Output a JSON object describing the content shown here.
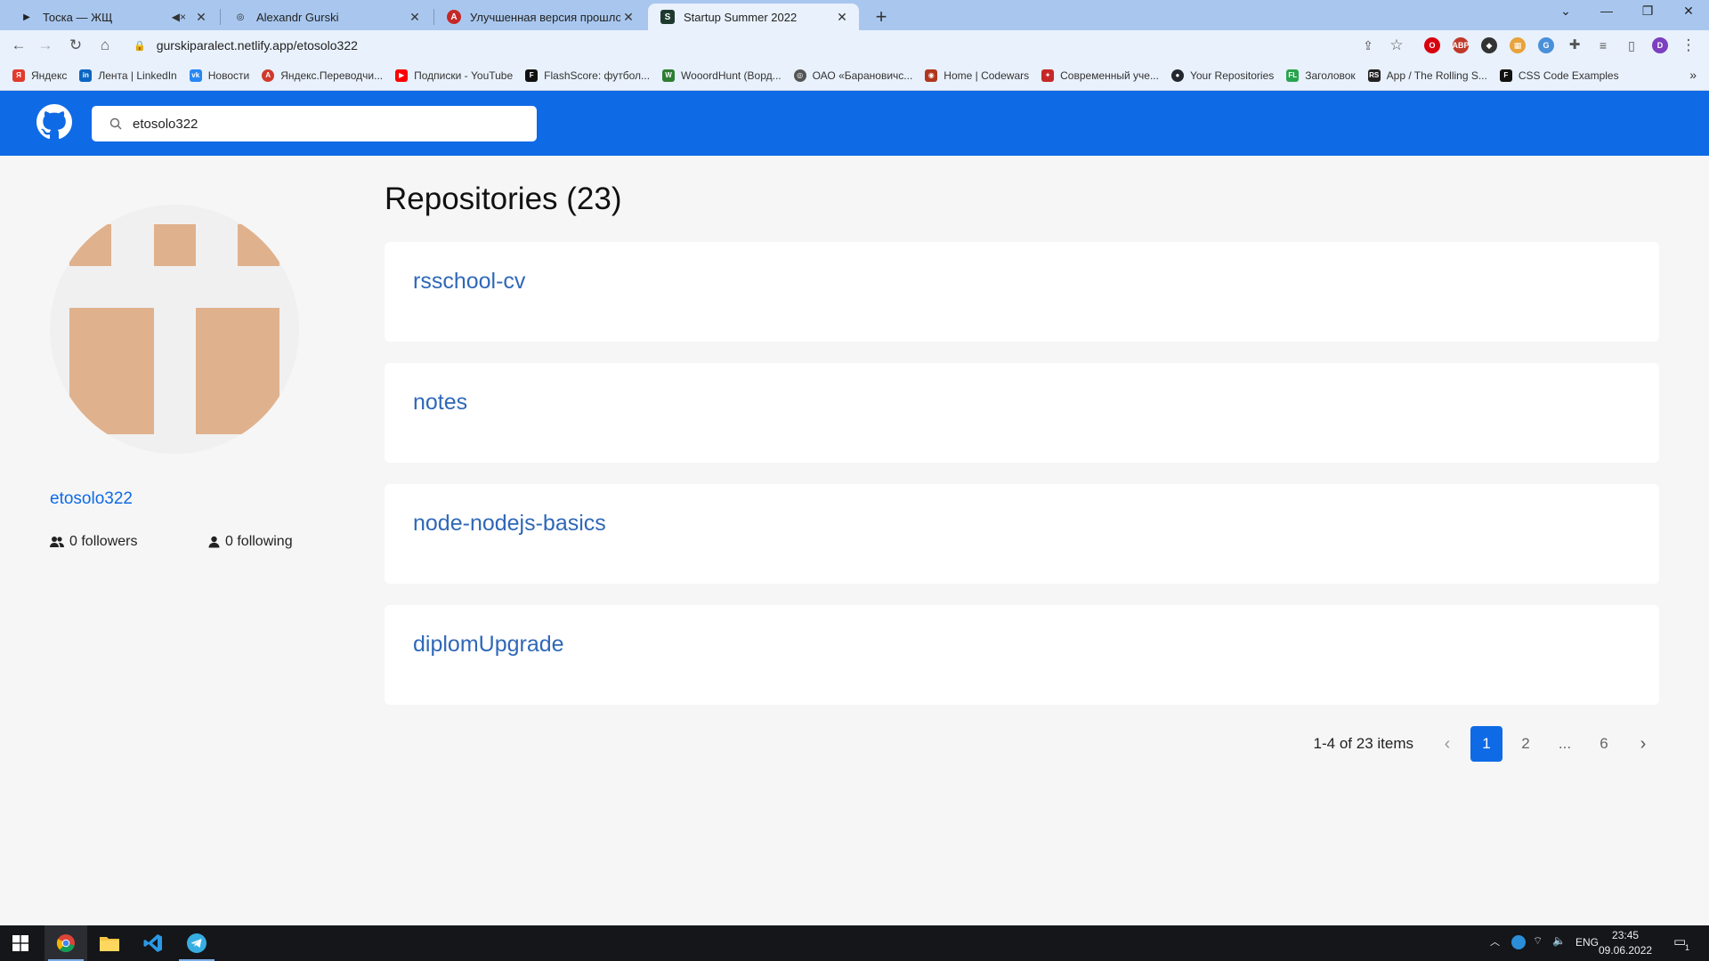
{
  "browser": {
    "tabs": [
      {
        "title": "Тоска — ЖЩ",
        "favicon": "youtube-play-icon"
      },
      {
        "title": "Alexandr Gurski",
        "favicon": "globe-icon"
      },
      {
        "title": "Улучшенная версия прошлого",
        "favicon": "translator-icon"
      },
      {
        "title": "Startup Summer 2022",
        "favicon": "ss-app-icon",
        "active": true
      }
    ],
    "url": "gurskiparalect.netlify.app/etosolo322",
    "profile_initial": "D",
    "bookmarks": [
      {
        "label": "Яндекс",
        "color": "#e03b2f"
      },
      {
        "label": "Лента | LinkedIn",
        "color": "#0a66c2"
      },
      {
        "label": "Новости",
        "color": "#2787f5"
      },
      {
        "label": "Яндекс.Переводчи...",
        "color": "#d03a2d"
      },
      {
        "label": "Подписки - YouTube",
        "color": "#ff0000"
      },
      {
        "label": "FlashScore: футбол...",
        "color": "#111111"
      },
      {
        "label": "WooordHunt (Ворд...",
        "color": "#2e7d32"
      },
      {
        "label": "ОАО «Барановичс...",
        "color": "#555555"
      },
      {
        "label": "Home | Codewars",
        "color": "#b1361e"
      },
      {
        "label": "Современный уче...",
        "color": "#c62828"
      },
      {
        "label": "Your Repositories",
        "color": "#24292f"
      },
      {
        "label": "Заголовок",
        "color": "#2aa44f"
      },
      {
        "label": "App / The Rolling S...",
        "color": "#222222"
      },
      {
        "label": "CSS Code Examples",
        "color": "#111111"
      }
    ]
  },
  "header": {
    "search_value": "etosolo322",
    "brand_color": "#0f6ae6"
  },
  "profile": {
    "username": "etosolo322",
    "followers": "0 followers",
    "following": "0 following"
  },
  "repos": {
    "title": "Repositories (23)",
    "items": [
      {
        "name": "rsschool-cv"
      },
      {
        "name": "notes"
      },
      {
        "name": "node-nodejs-basics"
      },
      {
        "name": "diplomUpgrade"
      }
    ]
  },
  "pagination": {
    "info": "1-4 of 23 items",
    "pages": [
      "1",
      "2",
      "...",
      "6"
    ],
    "current": "1"
  },
  "taskbar": {
    "lang": "ENG",
    "time": "23:45",
    "date": "09.06.2022",
    "notif_count": "1"
  }
}
